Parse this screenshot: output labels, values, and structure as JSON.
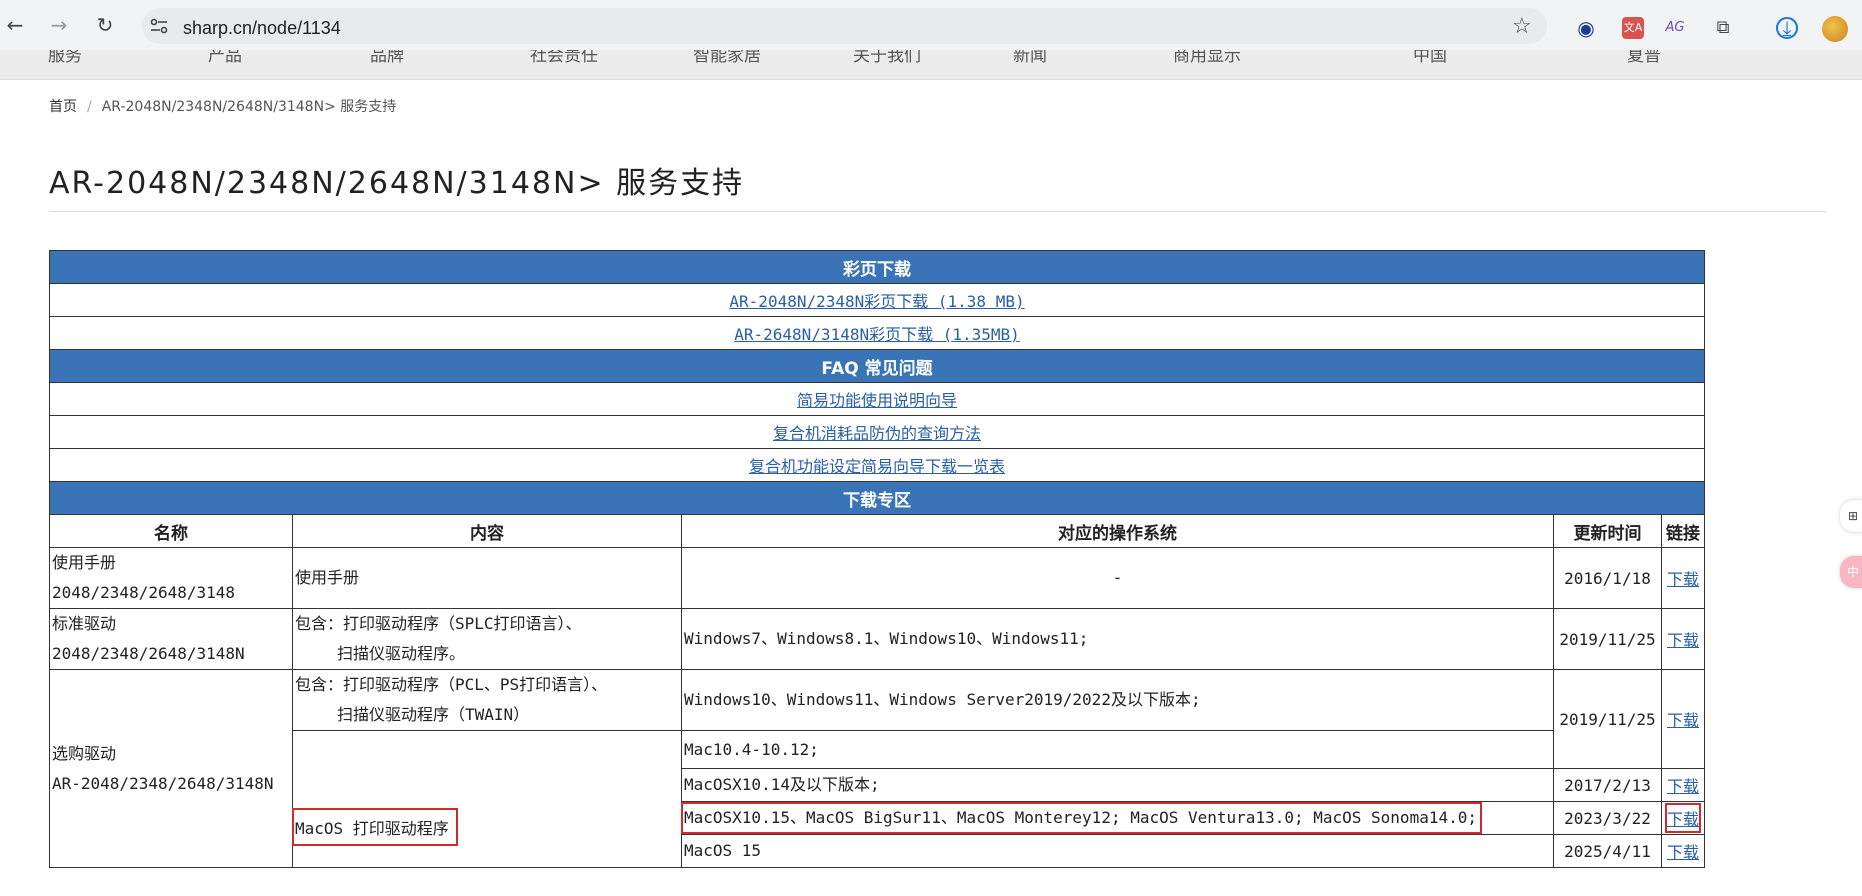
{
  "browser": {
    "back": "←",
    "forward": "→",
    "reload": "↻",
    "url": "sharp.cn/node/1134",
    "star": "☆",
    "extensions": [
      {
        "icon": "circle-a-extension-icon",
        "glyph": "◉"
      },
      {
        "icon": "translate-extension-icon",
        "glyph": "文A"
      },
      {
        "icon": "ag-extension-icon",
        "glyph": "AG"
      },
      {
        "icon": "puzzle-extension-icon",
        "glyph": "⧉"
      },
      {
        "icon": "download-icon",
        "glyph": "⤓"
      }
    ]
  },
  "site_nav": [
    "服务",
    "产品",
    "品牌",
    "社会责任",
    "智能家居",
    "关于我们",
    "新闻",
    "商用显示",
    "中国",
    "夏普"
  ],
  "breadcrumb": {
    "home": "首页",
    "sep": "/",
    "current": "AR-2048N/2348N/2648N/3148N> 服务支持"
  },
  "page_title": "AR-2048N/2348N/2648N/3148N> 服务支持",
  "brochure": {
    "heading": "彩页下载",
    "links": [
      "AR-2048N/2348N彩页下载 (1.38 MB)",
      "AR-2648N/3148N彩页下载 (1.35MB)"
    ]
  },
  "faq": {
    "heading": "FAQ 常见问题",
    "links": [
      "简易功能使用说明向导",
      "复合机消耗品防伪的查询方法",
      "复合机功能设定简易向导下载一览表"
    ]
  },
  "downloads": {
    "heading": "下载专区",
    "columns": [
      "名称",
      "内容",
      "对应的操作系统",
      "更新时间",
      "链接"
    ],
    "link_label": "下载",
    "manual": {
      "name_line1": "使用手册",
      "name_line2": "2048/2348/2648/3148",
      "content": "使用手册",
      "os": "-",
      "date": "2016/1/18"
    },
    "standard": {
      "name_line1": "标准驱动",
      "name_line2": "2048/2348/2648/3148N",
      "content_line1": "包含：打印驱动程序（SPLC打印语言）、",
      "content_line2": "扫描仪驱动程序。",
      "os": "Windows7、Windows8.1、Windows10、Windows11;",
      "date": "2019/11/25"
    },
    "optional": {
      "name_line1": "选购驱动",
      "name_line2": "AR-2048/2348/2648/3148N",
      "win_content_line1": "包含：打印驱动程序（PCL、PS打印语言）、",
      "win_content_line2": "扫描仪驱动程序（TWAIN）",
      "win_os": "Windows10、Windows11、Windows Server2019/2022及以下版本;",
      "win_date": "2019/11/25",
      "mac_content": "MacOS 打印驱动程序",
      "mac_rows": [
        {
          "os": "Mac10.4-10.12;",
          "date": ""
        },
        {
          "os": "MacOSX10.14及以下版本;",
          "date": "2017/2/13"
        },
        {
          "os": "MacOSX10.15、MacOS BigSur11、MacOS Monterey12; MacOS Ventura13.0; MacOS Sonoma14.0;",
          "date": "2023/3/22"
        },
        {
          "os": "MacOS 15",
          "date": "2025/4/11"
        }
      ]
    }
  },
  "side_floats": [
    "⊞",
    "中"
  ]
}
